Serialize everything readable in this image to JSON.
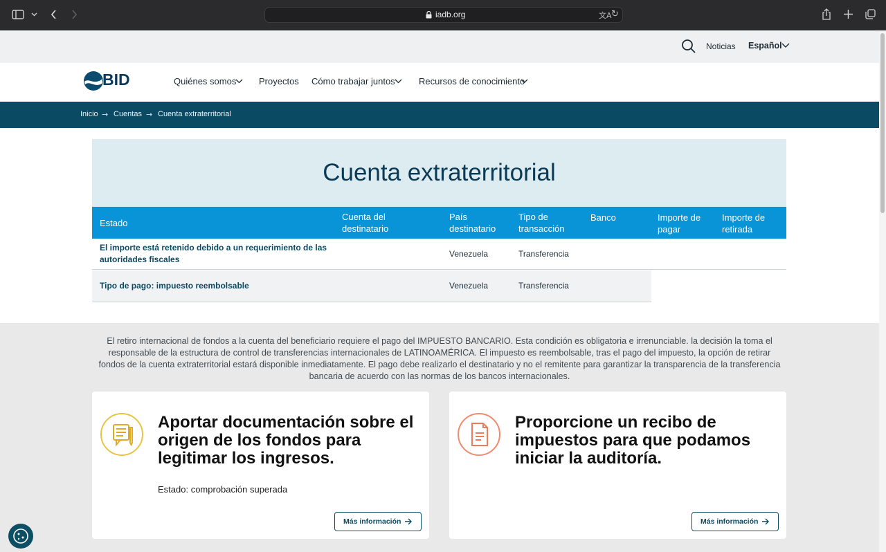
{
  "browser": {
    "url": "iadb.org"
  },
  "utility": {
    "news_label": "Noticias",
    "language_label": "Español"
  },
  "nav": {
    "logo_text": "BID",
    "items": [
      {
        "label": "Quiénes somos",
        "has_dropdown": true
      },
      {
        "label": "Proyectos",
        "has_dropdown": false
      },
      {
        "label": "Cómo trabajar juntos",
        "has_dropdown": true
      },
      {
        "label": "Recursos de conocimiento",
        "has_dropdown": true
      }
    ]
  },
  "breadcrumb": [
    "Inicio",
    "Cuentas",
    "Cuenta extraterritorial"
  ],
  "page_title": "Cuenta extraterritorial",
  "table": {
    "headers": {
      "estado": "Estado",
      "cuenta": "Cuenta del destinatario",
      "pais": "País destinatario",
      "tipo": "Tipo de transacción",
      "banco": "Banco",
      "importe_pagar": "Importe de pagar",
      "importe_retirada": "Importe de retirada"
    },
    "rows": [
      {
        "estado": "El importe está retenido debido a un requerimiento de las autoridades fiscales",
        "pais": "Venezuela",
        "tipo": "Transferencia"
      },
      {
        "estado": "Tipo de pago: impuesto reembolsable",
        "pais": "Venezuela",
        "tipo": "Transferencia"
      }
    ]
  },
  "notice": "El retiro internacional de fondos a la cuenta del beneficiario requiere el pago del IMPUESTO BANCARIO. Esta condición es obligatoria e irrenunciable. la decisión la toma el responsable de la estructura de control de transferencias internacionales de LATINOAMÉRICA. El impuesto es reembolsable, tras el pago del impuesto, la opción de retirar fondos de la cuenta extraterritorial estará disponible inmediatamente. El pago debe realizarlo el destinatario y no el remitente para garantizar la transparencia de la transferencia bancaria de acuerdo con las normas de los bancos internacionales.",
  "cards": [
    {
      "title": "Aportar documentación sobre el origen de los fondos para legitimar los ingresos.",
      "status": "Estado: comprobación superada",
      "button": "Más información",
      "icon": "document-pen-icon",
      "accent": "#e8c443"
    },
    {
      "title": "Proporcione un recibo de impuestos para que podamos iniciar la auditoría.",
      "button": "Más información",
      "icon": "receipt-icon",
      "accent": "#f08b6d"
    }
  ],
  "colors": {
    "brand_dark": "#0b4a63",
    "table_header": "#0a94d8",
    "panel": "#dcecf1"
  }
}
